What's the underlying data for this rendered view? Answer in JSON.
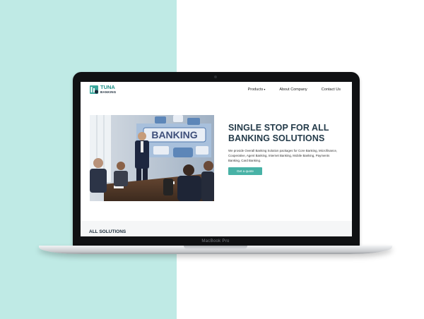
{
  "website": {
    "logo": {
      "line1": "TUNA",
      "line2": "BANKING"
    },
    "nav": [
      {
        "label": "Products",
        "has_dropdown": true
      },
      {
        "label": "About Company",
        "has_dropdown": false
      },
      {
        "label": "Contact Us",
        "has_dropdown": false
      }
    ],
    "hero": {
      "title": "SINGLE STOP FOR ALL BANKING SOLUTIONS",
      "description": "We provide Overall Banking Solution packages for Core Banking, Microfinance, Cooperative, Agent Banking, Internet Banking, Mobile Banking, Payments Banking, Card Banking.",
      "cta_label": "Get a quote",
      "image_sign_text": "BANKING"
    },
    "section": {
      "title": "ALL SOLUTIONS"
    }
  },
  "device": {
    "model_label": "MacBook Pro"
  },
  "colors": {
    "left_background": "#bfeae5",
    "accent": "#48b2a6",
    "heading": "#243b4a"
  }
}
